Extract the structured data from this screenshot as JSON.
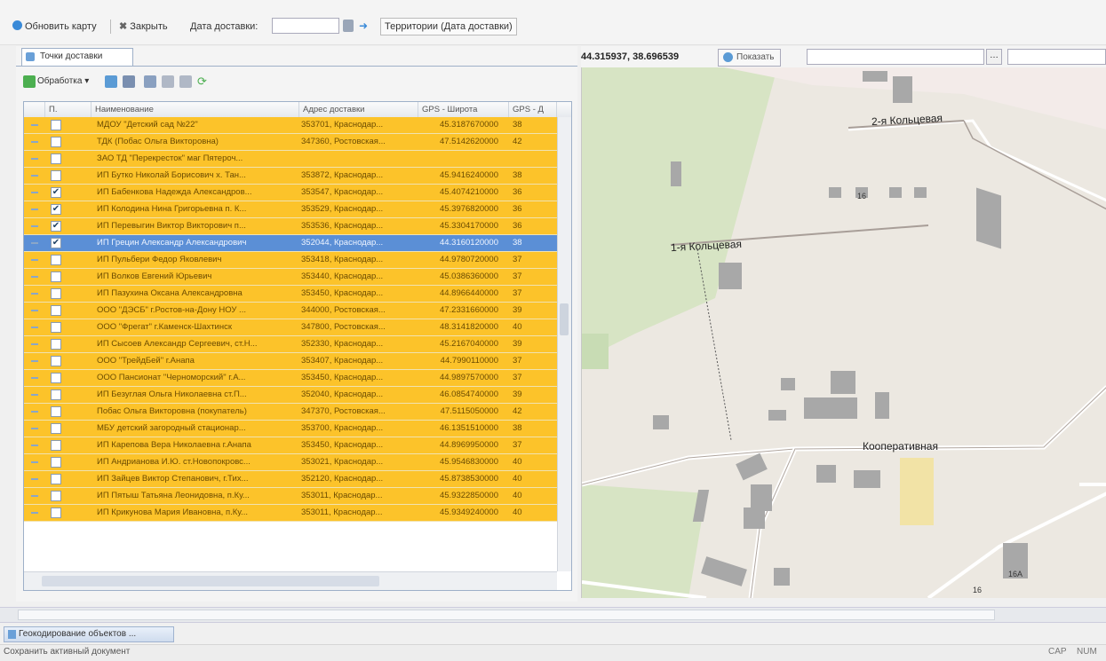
{
  "toolbar": {
    "refresh_label": "Обновить карту",
    "close_label": "Закрыть",
    "date_label": "Дата доставки:",
    "date_value": "",
    "territory_label": "Территории (Дата доставки)"
  },
  "left_panel": {
    "tab_label": "Точки доставки",
    "processing_label": "Обработка"
  },
  "grid": {
    "columns": [
      "П.",
      "Наименование",
      "Адрес доставки",
      "GPS - Широта",
      "GPS - Д"
    ],
    "rows": [
      {
        "checked": false,
        "name": "МДОУ \"Детский сад №22\"",
        "address": "353701, Краснодар...",
        "lat": "45.3187670000",
        "lon": "38"
      },
      {
        "checked": false,
        "name": "ТДК (Побас Ольга Викторовна)",
        "address": "347360, Ростовская...",
        "lat": "47.5142620000",
        "lon": "42"
      },
      {
        "checked": false,
        "name": "ЗАО ТД \"Перекресток\" маг Пятероч...",
        "address": "",
        "lat": "",
        "lon": ""
      },
      {
        "checked": false,
        "name": "ИП Бутко Николай Борисович х. Тан...",
        "address": "353872, Краснодар...",
        "lat": "45.9416240000",
        "lon": "38"
      },
      {
        "checked": true,
        "name": "ИП Бабенкова Надежда Александров...",
        "address": "353547, Краснодар...",
        "lat": "45.4074210000",
        "lon": "36"
      },
      {
        "checked": true,
        "name": "ИП Колодина Нина Григорьевна п. К...",
        "address": "353529, Краснодар...",
        "lat": "45.3976820000",
        "lon": "36"
      },
      {
        "checked": true,
        "name": "ИП Перевыгин Виктор Викторович п...",
        "address": "353536, Краснодар...",
        "lat": "45.3304170000",
        "lon": "36"
      },
      {
        "checked": true,
        "name": "ИП Грецин Александр Александрович",
        "address": "352044, Краснодар...",
        "lat": "44.3160120000",
        "lon": "38",
        "selected": true
      },
      {
        "checked": false,
        "name": "ИП Пульбери Федор Яковлевич",
        "address": "353418, Краснодар...",
        "lat": "44.9780720000",
        "lon": "37"
      },
      {
        "checked": false,
        "name": "ИП Волков Евгений Юрьевич",
        "address": "353440, Краснодар...",
        "lat": "45.0386360000",
        "lon": "37"
      },
      {
        "checked": false,
        "name": "ИП Пазухина Оксана Александровна",
        "address": "353450, Краснодар...",
        "lat": "44.8966440000",
        "lon": "37"
      },
      {
        "checked": false,
        "name": "ООО \"ДЭСБ\" г.Ростов-на-Дону НОУ ...",
        "address": "344000, Ростовская...",
        "lat": "47.2331660000",
        "lon": "39"
      },
      {
        "checked": false,
        "name": "ООО \"Фрегат\" г.Каменск-Шахтинск",
        "address": "347800, Ростовская...",
        "lat": "48.3141820000",
        "lon": "40"
      },
      {
        "checked": false,
        "name": "ИП Сысоев Александр Сергеевич, ст.Н...",
        "address": "352330, Краснодар...",
        "lat": "45.2167040000",
        "lon": "39"
      },
      {
        "checked": false,
        "name": "ООО \"ТрейдБей\" г.Анапа",
        "address": "353407, Краснодар...",
        "lat": "44.7990110000",
        "lon": "37"
      },
      {
        "checked": false,
        "name": "ООО Пансионат \"Черноморский\" г.А...",
        "address": "353450, Краснодар...",
        "lat": "44.9897570000",
        "lon": "37"
      },
      {
        "checked": false,
        "name": "ИП Безуглая Ольга Николаевна ст.П...",
        "address": "352040, Краснодар...",
        "lat": "46.0854740000",
        "lon": "39"
      },
      {
        "checked": false,
        "name": "Побас Ольга Викторовна (покупатель)",
        "address": "347370, Ростовская...",
        "lat": "47.5115050000",
        "lon": "42"
      },
      {
        "checked": false,
        "name": "МБУ детский загородный стационар...",
        "address": "353700, Краснодар...",
        "lat": "46.1351510000",
        "lon": "38"
      },
      {
        "checked": false,
        "name": "ИП Карепова Вера Николаевна г.Анапа",
        "address": "353450, Краснодар...",
        "lat": "44.8969950000",
        "lon": "37"
      },
      {
        "checked": false,
        "name": "ИП Андрианова И.Ю. ст.Новопокровс...",
        "address": "353021, Краснодар...",
        "lat": "45.9546830000",
        "lon": "40"
      },
      {
        "checked": false,
        "name": "ИП Зайцев Виктор Степанович, г.Тих...",
        "address": "352120, Краснодар...",
        "lat": "45.8738530000",
        "lon": "40"
      },
      {
        "checked": false,
        "name": "ИП Пятыш Татьяна Леонидовна, п.Ку...",
        "address": "353011, Краснодар...",
        "lat": "45.9322850000",
        "lon": "40"
      },
      {
        "checked": false,
        "name": "ИП Крикунова Мария Ивановна, п.Ку...",
        "address": "353011, Краснодар...",
        "lat": "45.9349240000",
        "lon": "40"
      }
    ]
  },
  "map": {
    "coordinates": "44.315937, 38.696539",
    "show_label": "Показать",
    "search_value": "",
    "labels": {
      "street1": "2-я Кольцевая",
      "street2": "1-я Кольцевая",
      "street3": "Кооперативная",
      "house1": "16",
      "house2": "16",
      "house3": "16А"
    }
  },
  "taskbar": {
    "window_label": "Геокодирование объектов ..."
  },
  "status": {
    "text": "Сохранить активный документ",
    "cap": "CAP",
    "num": "NUM"
  }
}
